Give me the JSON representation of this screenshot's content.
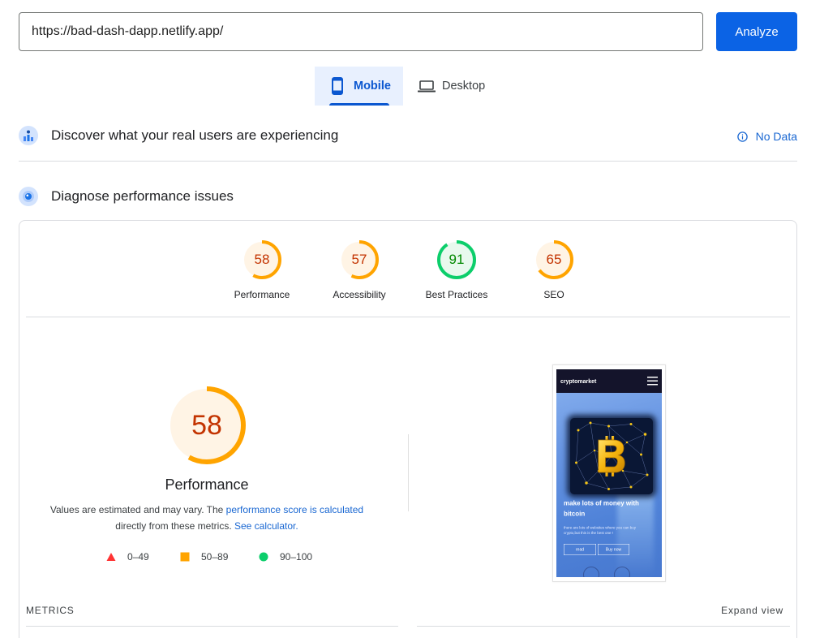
{
  "search": {
    "url": "https://bad-dash-dapp.netlify.app/",
    "analyze_label": "Analyze"
  },
  "tabs": [
    {
      "label": "Mobile",
      "icon": "smartphone-icon",
      "selected": true
    },
    {
      "label": "Desktop",
      "icon": "laptop-icon",
      "selected": false
    }
  ],
  "field_data": {
    "title": "Discover what your real users are experiencing",
    "icon": "field-data-icon",
    "status": "No Data",
    "status_icon": "info-icon"
  },
  "lab_data": {
    "title": "Diagnose performance issues",
    "icon": "lab-data-icon"
  },
  "scores": [
    {
      "label": "Performance",
      "value": 58
    },
    {
      "label": "Accessibility",
      "value": 57
    },
    {
      "label": "Best Practices",
      "value": 91
    },
    {
      "label": "SEO",
      "value": 65
    }
  ],
  "performance": {
    "value": 58,
    "label": "Performance",
    "note": {
      "text_1": "Values are estimated and may vary. The ",
      "link_1": "performance score is calculated",
      "text_2": "directly from these metrics. ",
      "link_2": "See calculator."
    }
  },
  "legend": [
    {
      "range": "0–49",
      "icon": "fail-triangle-icon"
    },
    {
      "range": "50–89",
      "icon": "average-square-icon"
    },
    {
      "range": "90–100",
      "icon": "pass-circle-icon"
    }
  ],
  "screenshot": {
    "site_name": "cryptomarket",
    "headline": "make lots of money with bitcoin",
    "tagline": "there are lots of websites where you can buy crypto,but this is the best one !",
    "buttons": [
      "read",
      "Buy now"
    ],
    "image_icon": "bitcoin-network-icon"
  },
  "metrics": {
    "title": "METRICS",
    "expand_label": "Expand view"
  },
  "colors": {
    "accent": "#0b57d0",
    "button": "#0b63e5",
    "link": "#1967d2",
    "fail": {
      "arc": "#ff4e42",
      "text": "#cc0000",
      "fill": "#fff0ef"
    },
    "average": {
      "arc": "#ffa400",
      "text": "#c33300",
      "fill": "#fff4e5"
    },
    "pass": {
      "arc": "#0cce6b",
      "text": "#008800",
      "fill": "#e8f9ee"
    }
  }
}
